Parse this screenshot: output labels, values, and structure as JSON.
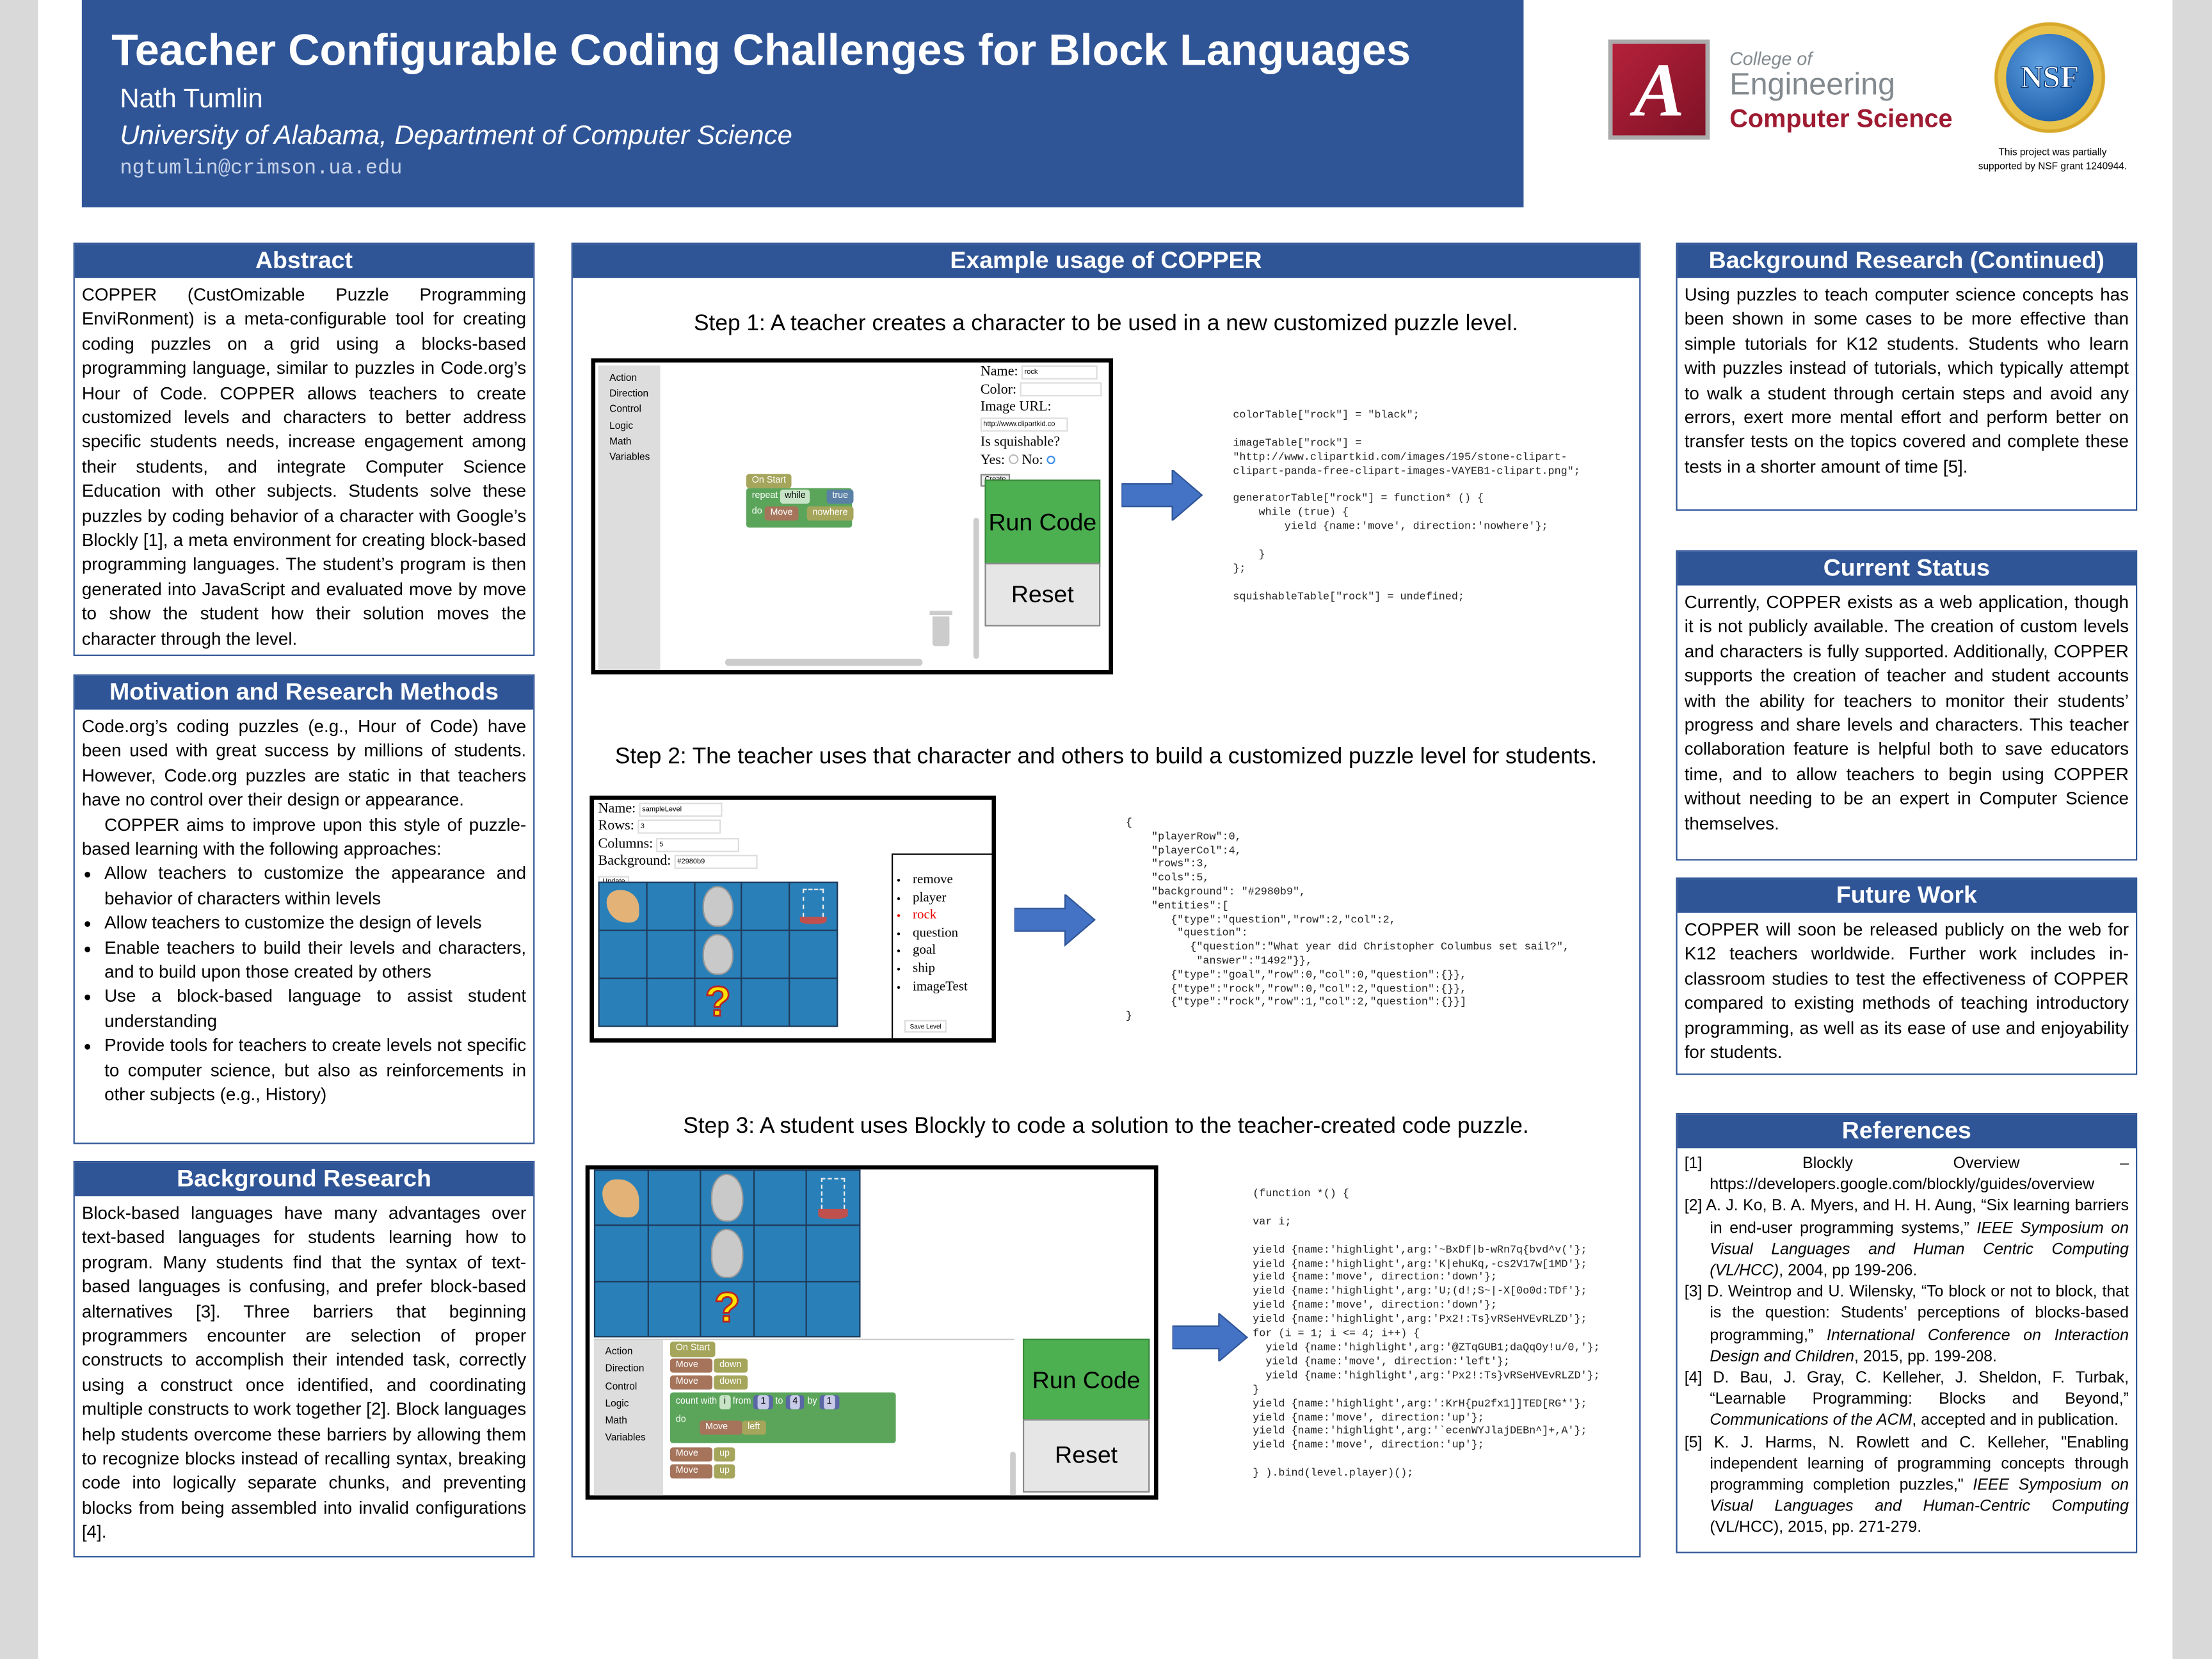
{
  "header": {
    "title": "Teacher Configurable Coding Challenges for Block Languages",
    "author": "Nath Tumlin",
    "affiliation": "University of Alabama, Department of Computer Science",
    "email": "ngtumlin@crimson.ua.edu",
    "logo_ua": {
      "line1": "College of",
      "line2": "Engineering",
      "line3": "Computer Science",
      "colors": {
        "crimson": "#9e1b32",
        "gray": "#828a8f"
      }
    },
    "logo_nsf": {
      "text": "NSF"
    },
    "grant_note_1": "This project was partially",
    "grant_note_2": "supported by NSF grant 1240944."
  },
  "colors": {
    "accent": "#2f5597",
    "run_button": "#4caf50",
    "grid_background": "#2980b9"
  },
  "abstract": {
    "heading": "Abstract",
    "text": "COPPER (CustOmizable Puzzle Programming EnviRonment) is a meta-configurable tool for creating coding puzzles on a grid using a blocks-based programming language, similar to puzzles in Code.org’s Hour of Code. COPPER allows teachers to create customized levels and characters to better address specific students needs, increase engagement among their students, and integrate Computer Science Education with other subjects. Students solve these puzzles by coding behavior of a character with Google’s Blockly [1], a meta environment for creating block-based programming languages. The student’s program is then generated into JavaScript and evaluated move by move to show the student how their solution moves the character through the level."
  },
  "motivation": {
    "heading": "Motivation and Research Methods",
    "p1": "Code.org’s coding puzzles (e.g., Hour of Code) have been used with great success by millions of students. However, Code.org puzzles are static in that teachers have no control over their design or appearance.",
    "p2": "COPPER aims to improve upon this style of puzzle-based learning with the following approaches:",
    "bullets": [
      "Allow teachers to customize the appearance and behavior of characters within levels",
      "Allow teachers to customize the design of levels",
      "Enable teachers to build their levels and characters, and to build upon those created by others",
      "Use a block-based language to assist student understanding",
      "Provide tools for teachers to create levels not specific to computer science, but also as reinforcements in other subjects (e.g., History)"
    ]
  },
  "background": {
    "heading": "Background Research",
    "text": "Block-based languages have many advantages over text-based languages for students learning how to program. Many students find that the syntax of text-based languages is confusing, and prefer block-based alternatives [3]. Three barriers that beginning programmers encounter are selection of proper constructs to accomplish their intended task, correctly using a construct once identified, and coordinating multiple constructs to work together [2]. Block languages help students overcome these barriers by allowing them to recognize blocks instead of recalling syntax, breaking code into logically separate chunks, and preventing blocks from being assembled into invalid configurations [4]."
  },
  "example": {
    "heading": "Example usage of COPPER",
    "step1": {
      "caption": "Step 1: A teacher creates a character to be used in a new customized puzzle level.",
      "toolbox": [
        "Action",
        "Direction",
        "Control",
        "Logic",
        "Math",
        "Variables"
      ],
      "blocks": {
        "on_start": "On Start",
        "repeat": "repeat",
        "while": "while",
        "true": "true",
        "do": "do",
        "move": "Move",
        "nowhere": "nowhere"
      },
      "form": {
        "name_label": "Name:",
        "name_value": "rock",
        "color_label": "Color:",
        "color_value": "",
        "image_label": "Image URL:",
        "image_value": "http://www.clipartkid.co",
        "squish_label": "Is squishable?",
        "yes_label": "Yes:",
        "no_label": "No:",
        "squishable": "No",
        "create_label": "Create"
      },
      "run_label": "Run Code",
      "reset_label": "Reset",
      "code": "colorTable[\"rock\"] = \"black\";\n\nimageTable[\"rock\"] =\n\"http://www.clipartkid.com/images/195/stone-clipart-\nclipart-panda-free-clipart-images-VAYEB1-clipart.png\";\n\ngeneratorTable[\"rock\"] = function* () {\n    while (true) {\n        yield {name:'move', direction:'nowhere'};\n\n    }\n};\n\nsquishableTable[\"rock\"] = undefined;"
    },
    "step2": {
      "caption": "Step 2: The teacher uses that character and others to build a customized puzzle level for students.",
      "form": {
        "name_label": "Name:",
        "name_value": "sampleLevel",
        "rows_label": "Rows:",
        "rows_value": "3",
        "cols_label": "Columns:",
        "cols_value": "5",
        "bg_label": "Background:",
        "bg_value": "#2980b9",
        "update_label": "Update"
      },
      "palette": [
        {
          "label": "remove",
          "selected": false
        },
        {
          "label": "player",
          "selected": false
        },
        {
          "label": "rock",
          "selected": true
        },
        {
          "label": "question",
          "selected": false
        },
        {
          "label": "goal",
          "selected": false
        },
        {
          "label": "ship",
          "selected": false
        },
        {
          "label": "imageTest",
          "selected": false
        }
      ],
      "save_label": "Save Level",
      "code": "{\n    \"playerRow\":0,\n    \"playerCol\":4,\n    \"rows\":3,\n    \"cols\":5,\n    \"background\": \"#2980b9\",\n    \"entities\":[\n       {\"type\":\"question\",\"row\":2,\"col\":2,\n        \"question\":\n          {\"question\":\"What year did Christopher Columbus set sail?\",\n           \"answer\":\"1492\"}},\n       {\"type\":\"goal\",\"row\":0,\"col\":0,\"question\":{}},\n       {\"type\":\"rock\",\"row\":0,\"col\":2,\"question\":{}},\n       {\"type\":\"rock\",\"row\":1,\"col\":2,\"question\":{}}]\n}"
    },
    "step3": {
      "caption": "Step 3: A student uses Blockly to code a solution to the teacher-created code puzzle.",
      "toolbox": [
        "Action",
        "Direction",
        "Control",
        "Logic",
        "Math",
        "Variables"
      ],
      "blocks": {
        "on_start": "On Start",
        "move": "Move",
        "down": "down",
        "count_with": "count with",
        "var": "i",
        "from": "from",
        "from_val": "1",
        "to": "to",
        "to_val": "4",
        "by": "by",
        "by_val": "1",
        "do": "do",
        "left": "left",
        "up": "up"
      },
      "run_label": "Run Code",
      "reset_label": "Reset",
      "code": "(function *() {\n\nvar i;\n\nyield {name:'highlight',arg:'~BxDf|b-wRn7q{bvd^v('};\nyield {name:'highlight',arg:'K|ehuKq,-cs2V17w[1MD'};\nyield {name:'move', direction:'down'};\nyield {name:'highlight',arg:'U;(d!;S~|-X[0o0d:TDf'};\nyield {name:'move', direction:'down'};\nyield {name:'highlight',arg:'Px2!:Ts}vRSeHVEvRLZD'};\nfor (i = 1; i <= 4; i++) {\n  yield {name:'highlight',arg:'@ZTqGUB1;daQqOy!u/0,'};\n  yield {name:'move', direction:'left'};\n  yield {name:'highlight',arg:'Px2!:Ts}vRSeHVEvRLZD'};\n}\nyield {name:'highlight',arg:':KrH{pu2fx1]]TED[RG*'};\nyield {name:'move', direction:'up'};\nyield {name:'highlight',arg:'`ecenWYJlajDEBn^]+,A'};\nyield {name:'move', direction:'up'};\n\n} ).bind(level.player)();"
    },
    "grid": {
      "rows": 3,
      "cols": 5,
      "entities": [
        {
          "type": "goal",
          "row": 0,
          "col": 0
        },
        {
          "type": "rock",
          "row": 0,
          "col": 2
        },
        {
          "type": "rock",
          "row": 1,
          "col": 2
        },
        {
          "type": "question",
          "row": 2,
          "col": 2
        },
        {
          "type": "ship",
          "row": 0,
          "col": 4
        }
      ],
      "question_glyph": "?"
    }
  },
  "background_cont": {
    "heading": "Background Research (Continued)",
    "text": "Using puzzles to teach computer science concepts has been shown in some cases to be more effective than simple tutorials for K12 students. Students who learn with puzzles instead of tutorials, which typically attempt to walk a student through certain steps and avoid any errors, exert more mental effort and perform better on transfer tests on the topics covered and complete these tests in a shorter amount of time [5]."
  },
  "current_status": {
    "heading": "Current Status",
    "text": "Currently, COPPER exists as a web application, though it is not publicly available. The creation of custom levels and characters is fully supported. Additionally, COPPER supports the creation of teacher and student accounts with the ability for teachers to monitor their students’ progress and share levels and characters. This teacher collaboration feature is helpful both to save educators time, and to allow teachers to begin using COPPER without needing to be an expert in Computer Science themselves."
  },
  "future_work": {
    "heading": "Future Work",
    "text": "COPPER will soon be released publicly on the web for K12 teachers worldwide. Further work includes in-classroom studies to test the effectiveness of COPPER compared to existing methods of teaching introductory programming, as well as its ease of use and enjoyability for students."
  },
  "references": {
    "heading": "References",
    "items": [
      {
        "pre": "[1] Blockly Overview – https://developers.google.com/blockly/guides/overview",
        "ital": "",
        "post": ""
      },
      {
        "pre": "[2] A. J. Ko, B. A. Myers, and H. H. Aung, “Six learning barriers in end-user programming systems,” ",
        "ital": "IEEE Symposium on Visual Languages and Human Centric Computing (VL/HCC)",
        "post": ", 2004, pp 199-206."
      },
      {
        "pre": "[3] D. Weintrop and U. Wilensky, “To block or not to block, that is the question: Students’ perceptions of blocks-based programming,” ",
        "ital": "International Conference on Interaction Design and Children",
        "post": ", 2015, pp. 199-208."
      },
      {
        "pre": "[4] D. Bau, J. Gray, C. Kelleher, J. Sheldon, F. Turbak, “Learnable Programming: Blocks and Beyond,” ",
        "ital": "Communications of the ACM",
        "post": ", accepted and in publication."
      },
      {
        "pre": "[5] K. J. Harms, N. Rowlett and C. Kelleher, \"Enabling independent learning of programming concepts through programming completion puzzles,\" ",
        "ital": "IEEE Symposium on Visual Languages and Human-Centric Computing",
        "post": " (VL/HCC), 2015, pp. 271-279."
      }
    ]
  }
}
